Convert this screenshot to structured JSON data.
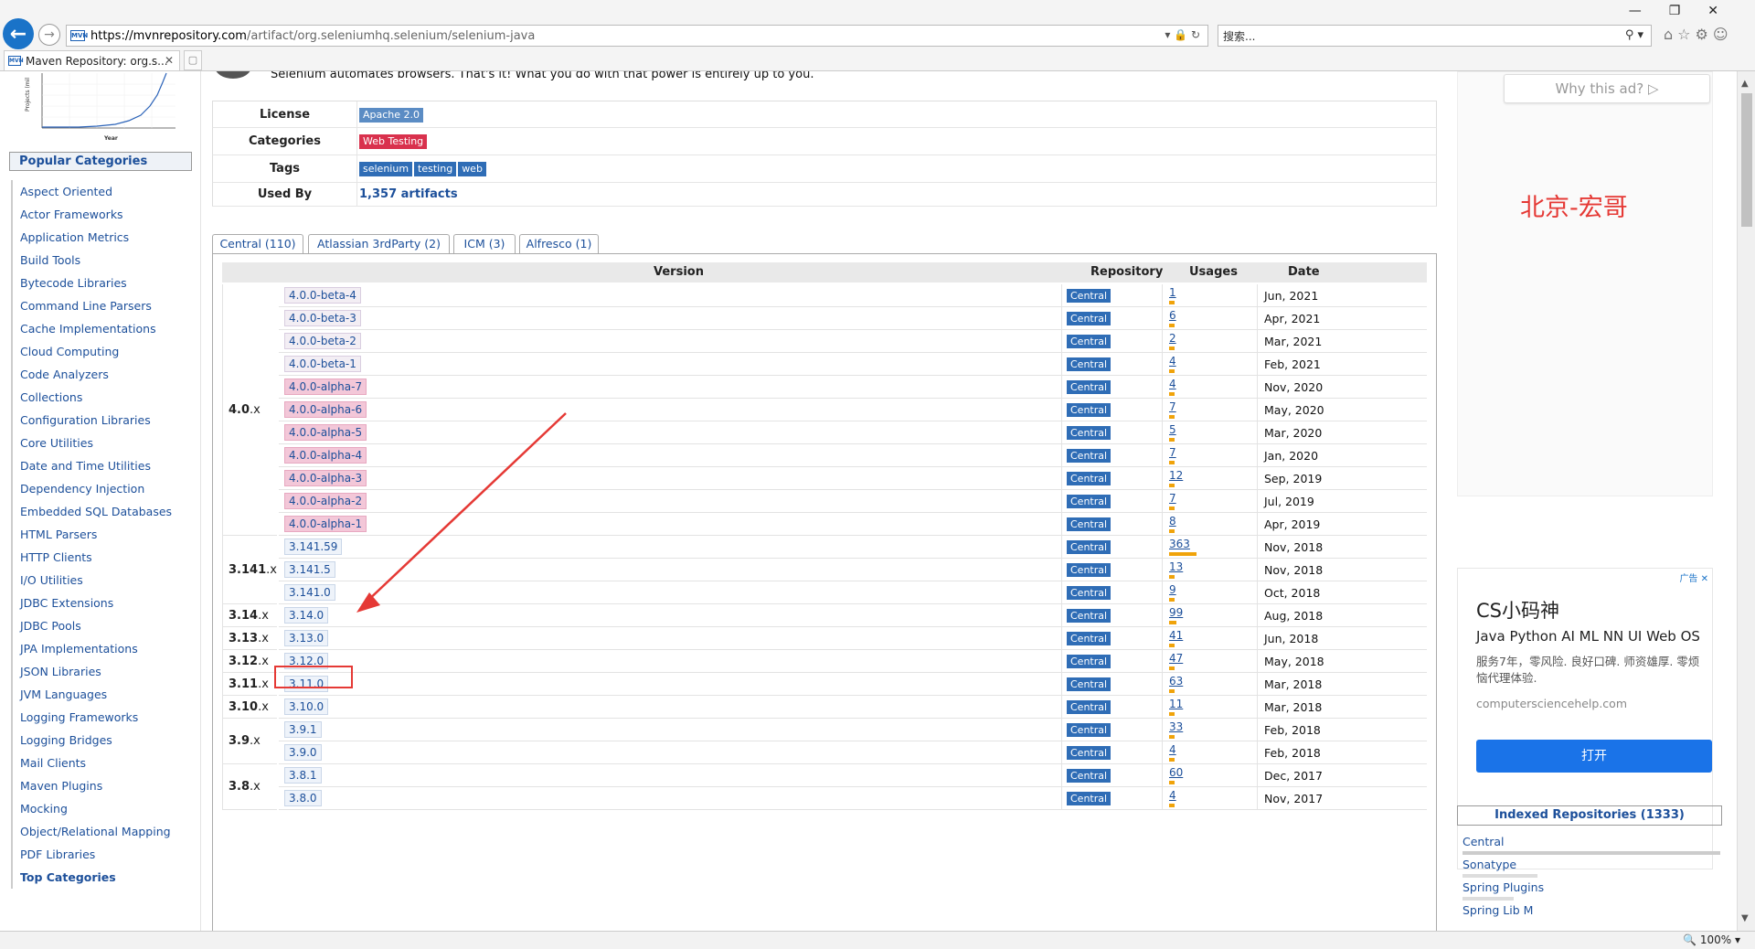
{
  "browser": {
    "url_main": "https://mvnrepository.com",
    "url_rest": "/artifact/org.seleniumhq.selenium/selenium-java",
    "search_placeholder": "搜索...",
    "tab_title": "Maven Repository: org.s...",
    "zoom": "100%",
    "favicon_text": "MVN"
  },
  "sidebar": {
    "heading": "Popular Categories",
    "items": [
      "Aspect Oriented",
      "Actor Frameworks",
      "Application Metrics",
      "Build Tools",
      "Bytecode Libraries",
      "Command Line Parsers",
      "Cache Implementations",
      "Cloud Computing",
      "Code Analyzers",
      "Collections",
      "Configuration Libraries",
      "Core Utilities",
      "Date and Time Utilities",
      "Dependency Injection",
      "Embedded SQL Databases",
      "HTML Parsers",
      "HTTP Clients",
      "I/O Utilities",
      "JDBC Extensions",
      "JDBC Pools",
      "JPA Implementations",
      "JSON Libraries",
      "JVM Languages",
      "Logging Frameworks",
      "Logging Bridges",
      "Mail Clients",
      "Maven Plugins",
      "Mocking",
      "Object/Relational Mapping",
      "PDF Libraries"
    ],
    "top_categories": "Top Categories",
    "mini_chart_ylabel": "Projects (mil",
    "mini_chart_xlabel": "Year"
  },
  "artifact": {
    "description": "Selenium automates browsers. That's it! What you do with that power is entirely up to you.",
    "license_label": "License",
    "license": "Apache 2.0",
    "categories_label": "Categories",
    "category": "Web Testing",
    "tags_label": "Tags",
    "tags": [
      "selenium",
      "testing",
      "web"
    ],
    "usedby_label": "Used By",
    "usedby": "1,357 artifacts"
  },
  "repo_tabs": [
    "Central (110)",
    "Atlassian 3rdParty (2)",
    "ICM (3)",
    "Alfresco (1)"
  ],
  "versions_header": {
    "version": "Version",
    "repository": "Repository",
    "usages": "Usages",
    "date": "Date"
  },
  "version_groups": [
    {
      "major": "4.0",
      "suffix": ".x",
      "rows": [
        {
          "v": "4.0.0-beta-4",
          "kind": "beta",
          "repo": "Central",
          "usages": "1",
          "date": "Jun, 2021"
        },
        {
          "v": "4.0.0-beta-3",
          "kind": "beta",
          "repo": "Central",
          "usages": "6",
          "date": "Apr, 2021"
        },
        {
          "v": "4.0.0-beta-2",
          "kind": "beta",
          "repo": "Central",
          "usages": "2",
          "date": "Mar, 2021"
        },
        {
          "v": "4.0.0-beta-1",
          "kind": "beta",
          "repo": "Central",
          "usages": "4",
          "date": "Feb, 2021"
        },
        {
          "v": "4.0.0-alpha-7",
          "kind": "alpha",
          "repo": "Central",
          "usages": "4",
          "date": "Nov, 2020"
        },
        {
          "v": "4.0.0-alpha-6",
          "kind": "alpha",
          "repo": "Central",
          "usages": "7",
          "date": "May, 2020"
        },
        {
          "v": "4.0.0-alpha-5",
          "kind": "alpha",
          "repo": "Central",
          "usages": "5",
          "date": "Mar, 2020"
        },
        {
          "v": "4.0.0-alpha-4",
          "kind": "alpha",
          "repo": "Central",
          "usages": "7",
          "date": "Jan, 2020"
        },
        {
          "v": "4.0.0-alpha-3",
          "kind": "alpha",
          "repo": "Central",
          "usages": "12",
          "date": "Sep, 2019"
        },
        {
          "v": "4.0.0-alpha-2",
          "kind": "alpha",
          "repo": "Central",
          "usages": "7",
          "date": "Jul, 2019"
        },
        {
          "v": "4.0.0-alpha-1",
          "kind": "alpha",
          "repo": "Central",
          "usages": "8",
          "date": "Apr, 2019"
        }
      ]
    },
    {
      "major": "3.141",
      "suffix": ".x",
      "rows": [
        {
          "v": "3.141.59",
          "kind": "release",
          "repo": "Central",
          "usages": "363",
          "date": "Nov, 2018"
        },
        {
          "v": "3.141.5",
          "kind": "release",
          "repo": "Central",
          "usages": "13",
          "date": "Nov, 2018"
        },
        {
          "v": "3.141.0",
          "kind": "release",
          "repo": "Central",
          "usages": "9",
          "date": "Oct, 2018"
        }
      ]
    },
    {
      "major": "3.14",
      "suffix": ".x",
      "rows": [
        {
          "v": "3.14.0",
          "kind": "release",
          "repo": "Central",
          "usages": "99",
          "date": "Aug, 2018"
        }
      ]
    },
    {
      "major": "3.13",
      "suffix": ".x",
      "rows": [
        {
          "v": "3.13.0",
          "kind": "release",
          "repo": "Central",
          "usages": "41",
          "date": "Jun, 2018"
        }
      ]
    },
    {
      "major": "3.12",
      "suffix": ".x",
      "rows": [
        {
          "v": "3.12.0",
          "kind": "release",
          "repo": "Central",
          "usages": "47",
          "date": "May, 2018"
        }
      ]
    },
    {
      "major": "3.11",
      "suffix": ".x",
      "rows": [
        {
          "v": "3.11.0",
          "kind": "release",
          "repo": "Central",
          "usages": "63",
          "date": "Mar, 2018"
        }
      ]
    },
    {
      "major": "3.10",
      "suffix": ".x",
      "rows": [
        {
          "v": "3.10.0",
          "kind": "release",
          "repo": "Central",
          "usages": "11",
          "date": "Mar, 2018"
        }
      ]
    },
    {
      "major": "3.9",
      "suffix": ".x",
      "rows": [
        {
          "v": "3.9.1",
          "kind": "release",
          "repo": "Central",
          "usages": "33",
          "date": "Feb, 2018"
        },
        {
          "v": "3.9.0",
          "kind": "release",
          "repo": "Central",
          "usages": "4",
          "date": "Feb, 2018"
        }
      ]
    },
    {
      "major": "3.8",
      "suffix": ".x",
      "rows": [
        {
          "v": "3.8.1",
          "kind": "release",
          "repo": "Central",
          "usages": "60",
          "date": "Dec, 2017"
        },
        {
          "v": "3.8.0",
          "kind": "release",
          "repo": "Central",
          "usages": "4",
          "date": "Nov, 2017"
        }
      ]
    }
  ],
  "right": {
    "why_ad": "Why this ad? ▷",
    "watermark": "北京-宏哥",
    "ad_badge": "广告 ✕",
    "ad_title": "CS小码神",
    "ad_sub": "Java Python AI ML NN UI Web OS",
    "ad_desc": "服务7年，零风险. 良好口碑. 师资雄厚. 零烦恼代理体验.",
    "ad_domain": "computersciencehelp.com",
    "ad_open": "打开",
    "indexed_heading": "Indexed Repositories (1333)",
    "indexed": [
      "Central",
      "Sonatype",
      "Spring Plugins",
      "Spring Lib M"
    ]
  },
  "colors": {
    "accent": "#1c4f9a",
    "usage_bar": "#f0a30a",
    "highlight": "#e53935"
  }
}
